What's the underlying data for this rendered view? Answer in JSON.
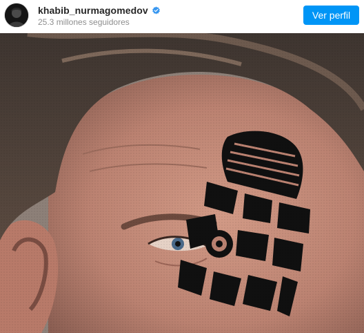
{
  "profile": {
    "username": "khabib_nurmagomedov",
    "followers": "25.3 millones seguidores",
    "verified": true,
    "verified_color": "#3897f0"
  },
  "actions": {
    "view_profile_label": "Ver perfil",
    "button_color": "#0095f6"
  },
  "post_image": {
    "icon": "post-photo"
  }
}
